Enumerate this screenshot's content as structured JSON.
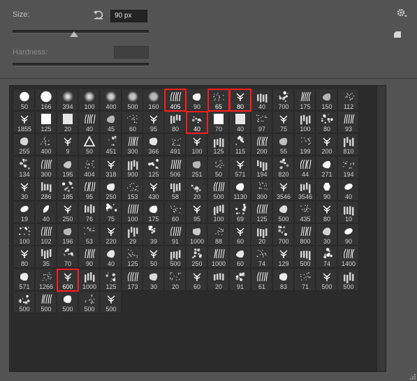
{
  "size": {
    "label": "Size:",
    "value": "90 px",
    "slider_fraction": 0.45
  },
  "hardness": {
    "label": "Hardness:",
    "value": ""
  },
  "icons": {
    "reset": "reset-size-icon",
    "gear": "gear-icon",
    "new_preset": "new-preset-icon",
    "resize": "resize-grip-icon"
  },
  "selection_color": "#ff1d1d",
  "brushes": [
    "50",
    "166",
    "394",
    "100",
    "400",
    "500",
    "160",
    "405",
    "90",
    "65",
    "80",
    "40",
    "700",
    "175",
    "150",
    "112",
    "1855",
    "125",
    "20",
    "40",
    "45",
    "60",
    "95",
    "80",
    "40",
    "70",
    "40",
    "97",
    "75",
    "100",
    "80",
    "93",
    "255",
    "400",
    "9",
    "50",
    "451",
    "300",
    "366",
    "491",
    "100",
    "125",
    "115",
    "200",
    "55",
    "199",
    "200",
    "810",
    "134",
    "300",
    "195",
    "404",
    "318",
    "900",
    "125",
    "506",
    "251",
    "50",
    "571",
    "194",
    "820",
    "44",
    "271",
    "194",
    "30",
    "286",
    "185",
    "95",
    "250",
    "153",
    "430",
    "58",
    "20",
    "500",
    "1130",
    "300",
    "3546",
    "3546",
    "90",
    "40",
    "19",
    "40",
    "250",
    "76",
    "75",
    "100",
    "175",
    "60",
    "95",
    "100",
    "69",
    "125",
    "500",
    "435",
    "80",
    "10",
    "100",
    "102",
    "196",
    "53",
    "220",
    "29",
    "39",
    "91",
    "1000",
    "88",
    "60",
    "20",
    "700",
    "800",
    "30",
    "90",
    "80",
    "35",
    "70",
    "90",
    "40",
    "125",
    "50",
    "500",
    "250",
    "1000",
    "60",
    "74",
    "129",
    "500",
    "74",
    "1400",
    "571",
    "1266",
    "600",
    "1000",
    "125",
    "173",
    "30",
    "20",
    "60",
    "20",
    "91",
    "61",
    "83",
    "71",
    "500",
    "500",
    "500",
    "500",
    "500",
    "500",
    "500"
  ],
  "selected_brushes": [
    7,
    9,
    10,
    24,
    130
  ]
}
